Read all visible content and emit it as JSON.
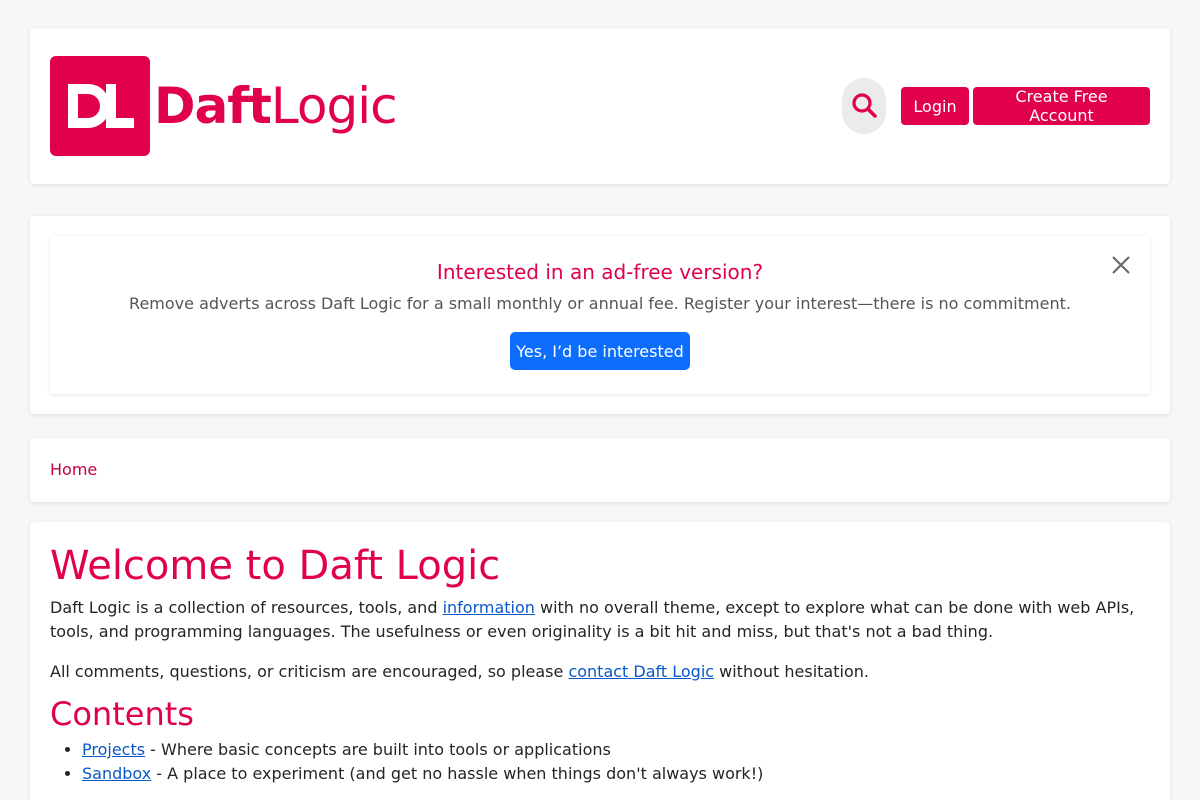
{
  "header": {
    "logo_bold": "Daft",
    "logo_light": "Logic",
    "login_label": "Login",
    "signup_label": "Create Free Account"
  },
  "banner": {
    "title": "Interested in an ad-free version?",
    "text": "Remove adverts across Daft Logic for a small monthly or annual fee. Register your interest—there is no commitment.",
    "button_label": "Yes, I’d be interested"
  },
  "breadcrumb": {
    "home": "Home"
  },
  "main": {
    "title": "Welcome to Daft Logic",
    "intro_before": "Daft Logic is a collection of resources, tools, and ",
    "intro_link": "information",
    "intro_after": " with no overall theme, except to explore what can be done with web APIs, tools, and programming languages. The usefulness or even originality is a bit hit and miss, but that's not a bad thing.",
    "comments_before": "All comments, questions, or criticism are encouraged, so please ",
    "comments_link": "contact Daft Logic",
    "comments_after": " without hesitation.",
    "contents_heading": "Contents",
    "contents": [
      {
        "link": "Projects",
        "desc": " - Where basic concepts are built into tools or applications"
      },
      {
        "link": "Sandbox",
        "desc": " - A place to experiment (and get no hassle when things don't always work!)"
      }
    ]
  },
  "colors": {
    "brand": "#e0004d",
    "primary_button": "#0d6efd",
    "link": "#0a58ca"
  }
}
